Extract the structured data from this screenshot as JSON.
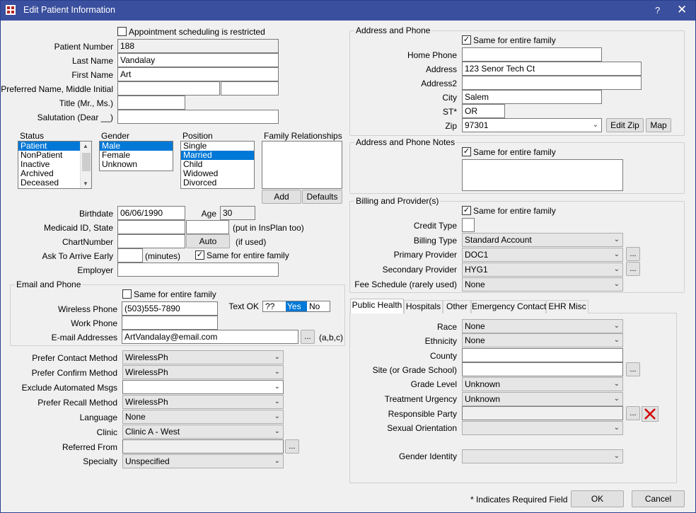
{
  "window": {
    "title": "Edit Patient Information",
    "help": "?",
    "close": "✕"
  },
  "left": {
    "appt_restricted": "Appointment scheduling is restricted",
    "patient_number": {
      "label": "Patient Number",
      "value": "188"
    },
    "last_name": {
      "label": "Last Name",
      "value": "Vandalay"
    },
    "first_name": {
      "label": "First Name",
      "value": "Art"
    },
    "preferred": {
      "label": "Preferred Name, Middle Initial",
      "value": "",
      "value2": ""
    },
    "title": {
      "label": "Title (Mr., Ms.)",
      "value": ""
    },
    "salutation": {
      "label": "Salutation (Dear __)",
      "value": ""
    },
    "status": {
      "label": "Status",
      "items": [
        "Patient",
        "NonPatient",
        "Inactive",
        "Archived",
        "Deceased"
      ],
      "selected": "Patient"
    },
    "gender": {
      "label": "Gender",
      "items": [
        "Male",
        "Female",
        "Unknown"
      ],
      "selected": "Male"
    },
    "position": {
      "label": "Position",
      "items": [
        "Single",
        "Married",
        "Child",
        "Widowed",
        "Divorced"
      ],
      "selected": "Married"
    },
    "family": {
      "label": "Family Relationships",
      "add": "Add",
      "defaults": "Defaults"
    },
    "birthdate": {
      "label": "Birthdate",
      "value": "06/06/1990"
    },
    "age": {
      "label": "Age",
      "value": "30"
    },
    "medicaid": {
      "label": "Medicaid ID, State",
      "value": "",
      "state": "",
      "note": "(put in InsPlan too)"
    },
    "chart": {
      "label": "ChartNumber",
      "value": "",
      "auto": "Auto",
      "note": "(if used)"
    },
    "arrive_early": {
      "label": "Ask To Arrive Early",
      "value": "",
      "note": "(minutes)",
      "same_family": "Same for entire family"
    },
    "employer": {
      "label": "Employer",
      "value": ""
    },
    "email_phone": {
      "title": "Email and Phone",
      "same_family": "Same for entire family",
      "wireless": {
        "label": "Wireless Phone",
        "value": "(503)555-7890"
      },
      "text_ok": {
        "label": "Text OK",
        "options": [
          "??",
          "Yes",
          "No"
        ],
        "selected": "Yes"
      },
      "work": {
        "label": "Work Phone",
        "value": ""
      },
      "email": {
        "label": "E-mail Addresses",
        "value": "ArtVandalay@email.com",
        "note": "(a,b,c)"
      }
    },
    "prefs": [
      {
        "label": "Prefer Contact Method",
        "value": "WirelessPh"
      },
      {
        "label": "Prefer Confirm Method",
        "value": "WirelessPh"
      },
      {
        "label": "Exclude Automated Msgs",
        "value": ""
      },
      {
        "label": "Prefer Recall Method",
        "value": "WirelessPh"
      },
      {
        "label": "Language",
        "value": "None"
      },
      {
        "label": "Clinic",
        "value": "Clinic A - West"
      }
    ],
    "referred": {
      "label": "Referred From",
      "value": ""
    },
    "specialty": {
      "label": "Specialty",
      "value": "Unspecified"
    }
  },
  "right": {
    "address": {
      "title": "Address and Phone",
      "same_family": "Same for entire family",
      "home_phone": {
        "label": "Home Phone",
        "value": ""
      },
      "address": {
        "label": "Address",
        "value": "123 Senor Tech Ct"
      },
      "address2": {
        "label": "Address2",
        "value": ""
      },
      "city": {
        "label": "City",
        "value": "Salem"
      },
      "st": {
        "label": "ST*",
        "value": "OR"
      },
      "zip": {
        "label": "Zip",
        "value": "97301"
      },
      "edit_zip": "Edit Zip",
      "map": "Map"
    },
    "notes": {
      "title": "Address and Phone Notes",
      "same_family": "Same for entire family",
      "value": ""
    },
    "billing": {
      "title": "Billing and Provider(s)",
      "same_family": "Same for entire family",
      "credit_type": {
        "label": "Credit Type",
        "value": ""
      },
      "billing_type": {
        "label": "Billing Type",
        "value": "Standard Account"
      },
      "primary": {
        "label": "Primary Provider",
        "value": "DOC1"
      },
      "secondary": {
        "label": "Secondary Provider",
        "value": "HYG1"
      },
      "fee": {
        "label": "Fee Schedule (rarely used)",
        "value": "None"
      }
    },
    "tabs": [
      "Public Health",
      "Hospitals",
      "Other",
      "Emergency Contact",
      "EHR Misc"
    ],
    "public_health": {
      "race": {
        "label": "Race",
        "value": "None"
      },
      "ethnicity": {
        "label": "Ethnicity",
        "value": "None"
      },
      "county": {
        "label": "County",
        "value": ""
      },
      "site": {
        "label": "Site (or Grade School)",
        "value": ""
      },
      "grade": {
        "label": "Grade Level",
        "value": "Unknown"
      },
      "urgency": {
        "label": "Treatment Urgency",
        "value": "Unknown"
      },
      "responsible": {
        "label": "Responsible Party",
        "value": ""
      },
      "orientation": {
        "label": "Sexual Orientation",
        "value": ""
      },
      "gender_identity": {
        "label": "Gender Identity",
        "value": ""
      }
    }
  },
  "footer": {
    "required_note": "* Indicates Required Field",
    "ok": "OK",
    "cancel": "Cancel"
  },
  "colors": {
    "titlebar": "#3a4f9e",
    "selection": "#0078d7",
    "delete_x": "#d00000"
  },
  "icons": {
    "ellipsis": "...",
    "dropdown": "chevron-down-icon",
    "delete": "red-x-icon"
  }
}
